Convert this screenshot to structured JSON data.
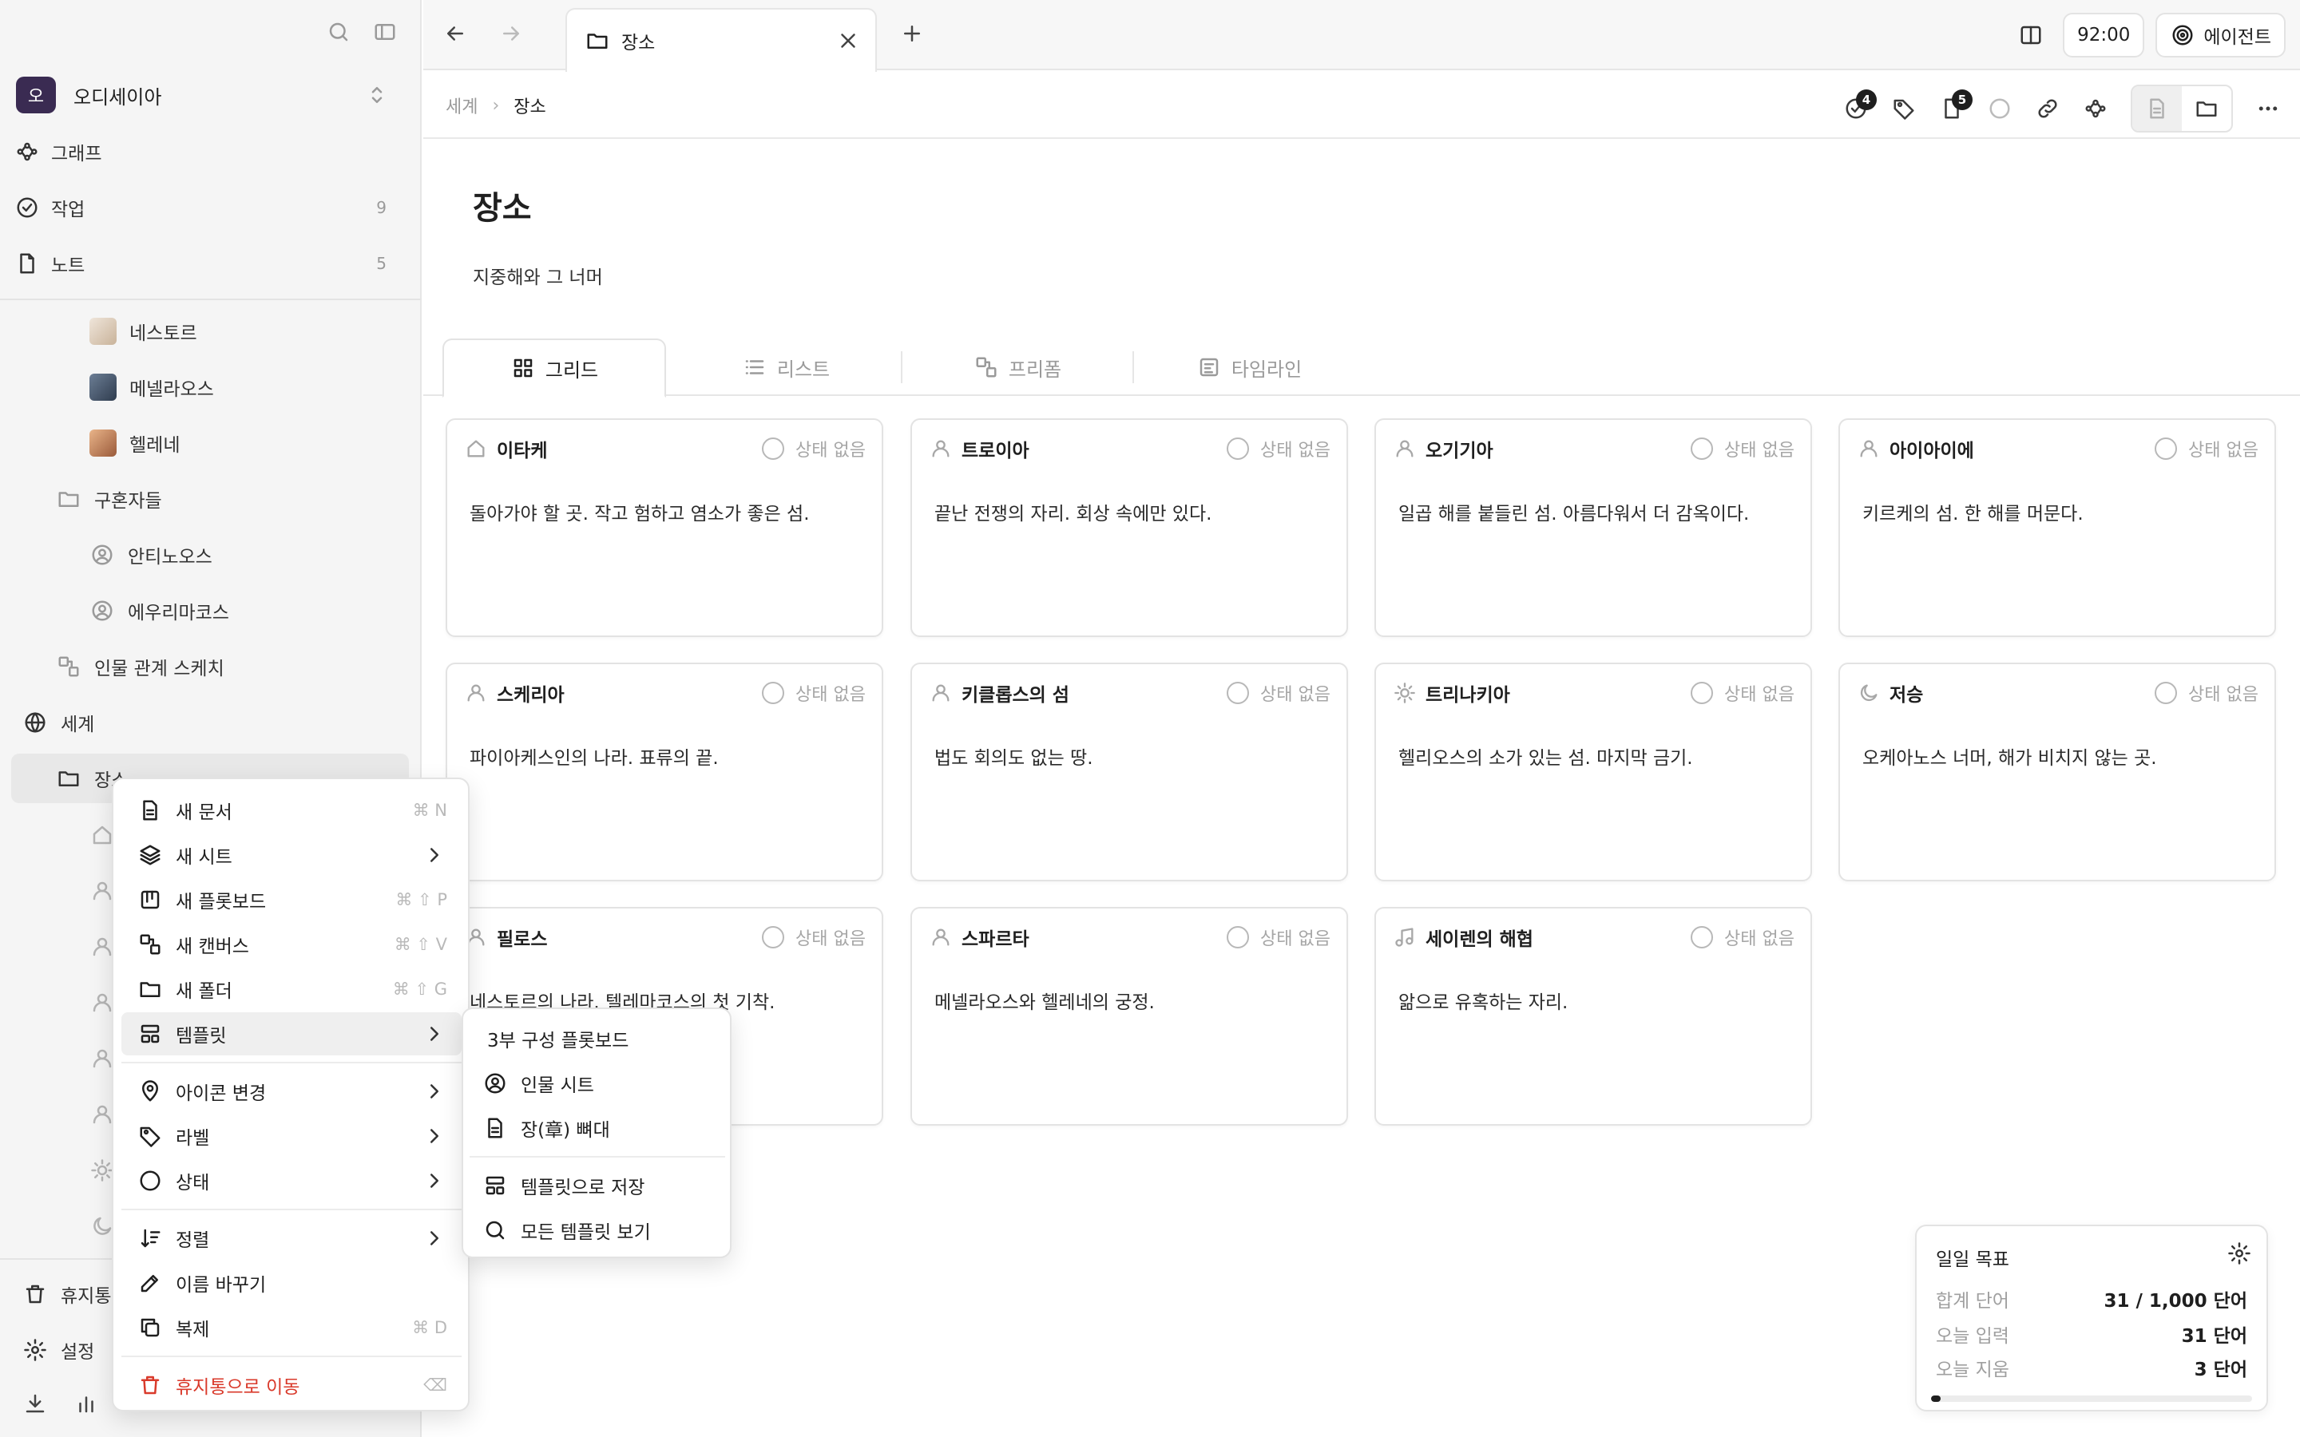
{
  "sidebar": {
    "workspace": {
      "initial": "오",
      "name": "오디세이아"
    },
    "nav": [
      {
        "label": "그래프",
        "count": ""
      },
      {
        "label": "작업",
        "count": "9"
      },
      {
        "label": "노트",
        "count": "5"
      }
    ],
    "tree": [
      {
        "label": "네스토르"
      },
      {
        "label": "메넬라오스"
      },
      {
        "label": "헬레네"
      },
      {
        "label": "구혼자들"
      },
      {
        "label": "안티노오스"
      },
      {
        "label": "에우리마코스"
      },
      {
        "label": "인물 관계 스케치"
      },
      {
        "label": "세계"
      },
      {
        "label": "장소"
      }
    ],
    "footer": {
      "trash": "휴지통",
      "settings": "설정"
    }
  },
  "tabbar": {
    "tab_title": "장소",
    "timer": "92:00",
    "agent": "에이전트"
  },
  "breadcrumb": {
    "parent": "세계",
    "current": "장소"
  },
  "toolbar": {
    "tasks_badge": "4",
    "notes_badge": "5"
  },
  "page": {
    "title": "장소",
    "subtitle": "지중해와 그 너머"
  },
  "views": [
    {
      "label": "그리드"
    },
    {
      "label": "리스트"
    },
    {
      "label": "프리폼"
    },
    {
      "label": "타임라인"
    }
  ],
  "status_label": "상태 없음",
  "cards": [
    {
      "name": "이타케",
      "desc": "돌아가야 할 곳. 작고 험하고 염소가 좋은 섬.",
      "icon": "home-icon"
    },
    {
      "name": "트로이아",
      "desc": "끝난 전쟁의 자리. 회상 속에만 있다.",
      "icon": "person-icon"
    },
    {
      "name": "오기기아",
      "desc": "일곱 해를 붙들린 섬. 아름다워서 더 감옥이다.",
      "icon": "person-icon"
    },
    {
      "name": "아이아이에",
      "desc": "키르케의 섬. 한 해를 머문다.",
      "icon": "person-icon"
    },
    {
      "name": "스케리아",
      "desc": "파이아케스인의 나라. 표류의 끝.",
      "icon": "person-icon"
    },
    {
      "name": "키클롭스의 섬",
      "desc": "법도 회의도 없는 땅.",
      "icon": "person-icon"
    },
    {
      "name": "트리나키아",
      "desc": "헬리오스의 소가 있는 섬. 마지막 금기.",
      "icon": "sun-icon"
    },
    {
      "name": "저승",
      "desc": "오케아노스 너머, 해가 비치지 않는 곳.",
      "icon": "moon-icon"
    },
    {
      "name": "필로스",
      "desc": "네스토르의 나라. 텔레마코스의 첫 기착.",
      "icon": "person-icon"
    },
    {
      "name": "스파르타",
      "desc": "메넬라오스와 헬레네의 궁정.",
      "icon": "person-icon"
    },
    {
      "name": "세이렌의 해협",
      "desc": "앎으로 유혹하는 자리.",
      "icon": "music-icon"
    }
  ],
  "goals": {
    "title": "일일 목표",
    "rows": [
      {
        "k": "합계 단어",
        "v": "31 / 1,000 단어"
      },
      {
        "k": "오늘 입력",
        "v": "31 단어"
      },
      {
        "k": "오늘 지움",
        "v": "3 단어"
      }
    ],
    "progress": 0.031
  },
  "context_menu": {
    "items": [
      {
        "label": "새 문서",
        "shortcut": "⌘ N"
      },
      {
        "label": "새 시트",
        "shortcut": ""
      },
      {
        "label": "새 플롯보드",
        "shortcut": "⌘ ⇧ P"
      },
      {
        "label": "새 캔버스",
        "shortcut": "⌘ ⇧ V"
      },
      {
        "label": "새 폴더",
        "shortcut": "⌘ ⇧ G"
      },
      {
        "label": "템플릿",
        "shortcut": ""
      },
      {
        "label": "아이콘 변경",
        "shortcut": ""
      },
      {
        "label": "라벨",
        "shortcut": ""
      },
      {
        "label": "상태",
        "shortcut": ""
      },
      {
        "label": "정렬",
        "shortcut": ""
      },
      {
        "label": "이름 바꾸기",
        "shortcut": ""
      },
      {
        "label": "복제",
        "shortcut": "⌘ D"
      },
      {
        "label": "휴지통으로 이동",
        "shortcut": "⌫"
      }
    ]
  },
  "template_submenu": {
    "items": [
      {
        "label": "3부 구성 플롯보드"
      },
      {
        "label": "인물 시트"
      },
      {
        "label": "장(章) 뼈대"
      },
      {
        "label": "템플릿으로 저장"
      },
      {
        "label": "모든 템플릿 보기"
      }
    ]
  }
}
